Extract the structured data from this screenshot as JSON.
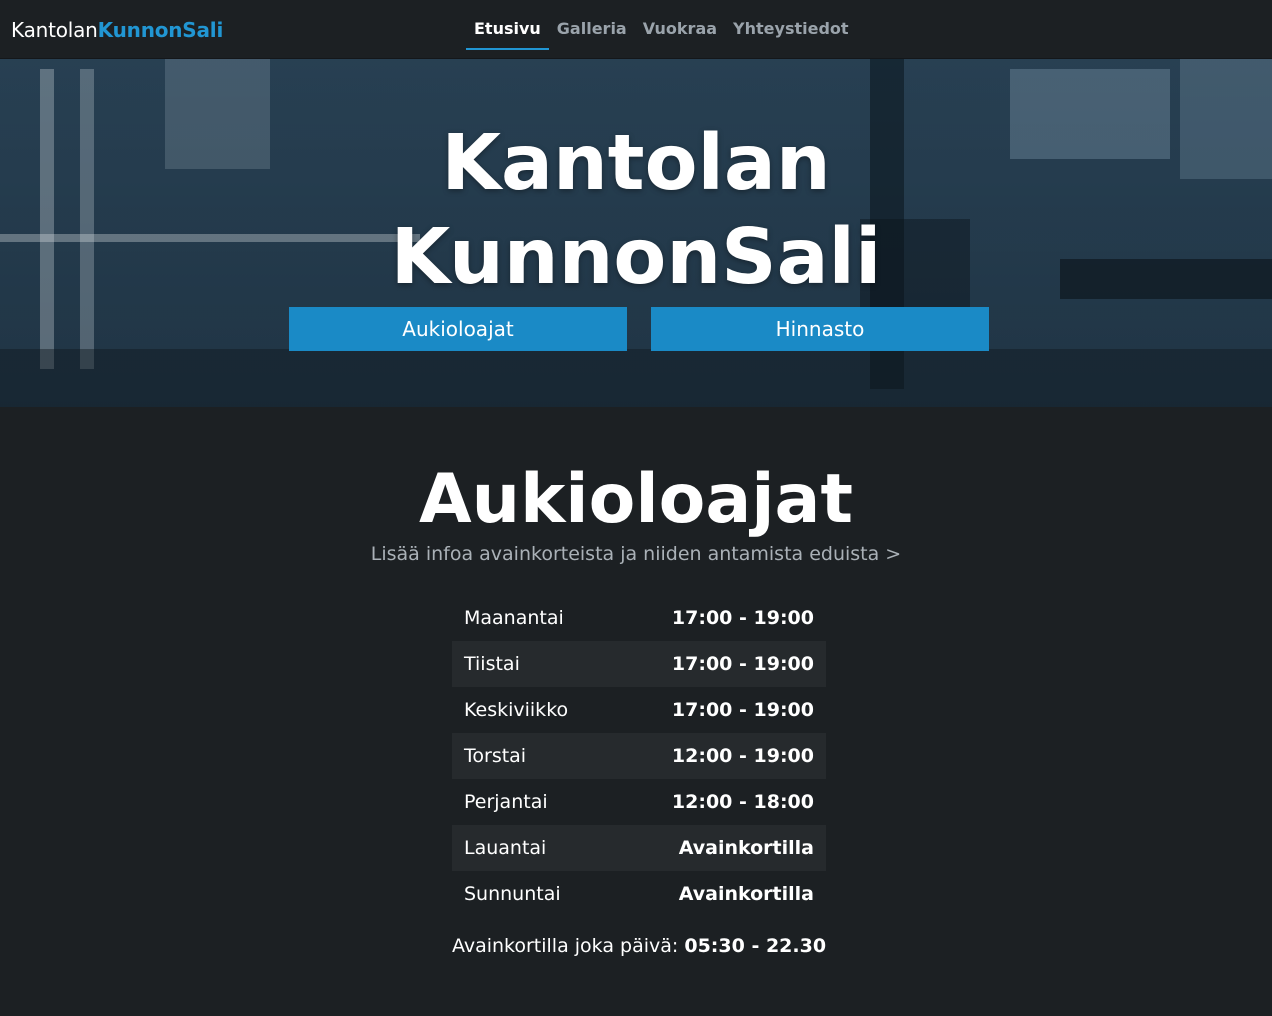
{
  "navbar": {
    "brand_part1": "Kantolan",
    "brand_part2": "KunnonSali",
    "items": [
      {
        "label": "Etusivu",
        "active": true
      },
      {
        "label": "Galleria",
        "active": false
      },
      {
        "label": "Vuokraa",
        "active": false
      },
      {
        "label": "Yhteystiedot",
        "active": false
      }
    ]
  },
  "hero": {
    "title_line1": "Kantolan",
    "title_line2": "KunnonSali",
    "buttons": [
      {
        "label": "Aukioloajat"
      },
      {
        "label": "Hinnasto"
      }
    ]
  },
  "hours_section": {
    "title": "Aukioloajat",
    "subtitle": "Lisää infoa avainkorteista ja niiden antamista eduista >",
    "rows": [
      {
        "day": "Maanantai",
        "time": "17:00 - 19:00"
      },
      {
        "day": "Tiistai",
        "time": "17:00 - 19:00"
      },
      {
        "day": "Keskiviikko",
        "time": "17:00 - 19:00"
      },
      {
        "day": "Torstai",
        "time": "12:00 - 19:00"
      },
      {
        "day": "Perjantai",
        "time": "12:00 - 18:00"
      },
      {
        "day": "Lauantai",
        "time": "Avainkortilla"
      },
      {
        "day": "Sunnuntai",
        "time": "Avainkortilla"
      }
    ],
    "note_label": "Avainkortilla joka päivä:",
    "note_value": "05:30 - 22.30"
  },
  "colors": {
    "accent": "#2196d3",
    "button": "#1a8ac6",
    "background": "#1c2023",
    "row_alt": "#262a2d"
  }
}
